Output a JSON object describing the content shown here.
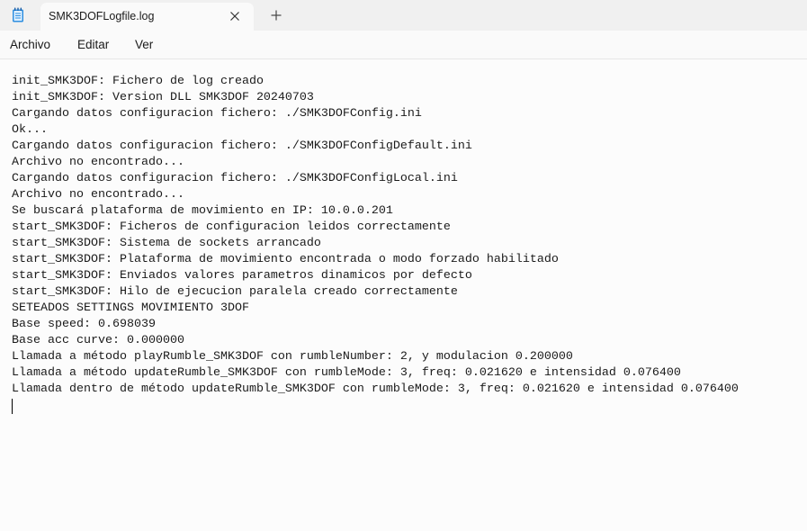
{
  "window": {
    "tab_title": "SMK3DOFLogfile.log"
  },
  "icons": {
    "app": "notepad-icon",
    "close": "close-icon",
    "new_tab": "plus-icon"
  },
  "menu": {
    "items": [
      "Archivo",
      "Editar",
      "Ver"
    ]
  },
  "editor": {
    "lines": [
      "init_SMK3DOF: Fichero de log creado",
      "init_SMK3DOF: Version DLL SMK3DOF 20240703",
      "Cargando datos configuracion fichero: ./SMK3DOFConfig.ini",
      "Ok...",
      "Cargando datos configuracion fichero: ./SMK3DOFConfigDefault.ini",
      "Archivo no encontrado...",
      "Cargando datos configuracion fichero: ./SMK3DOFConfigLocal.ini",
      "Archivo no encontrado...",
      "Se buscará plataforma de movimiento en IP: 10.0.0.201",
      "start_SMK3DOF: Ficheros de configuracion leidos correctamente",
      "start_SMK3DOF: Sistema de sockets arrancado",
      "start_SMK3DOF: Plataforma de movimiento encontrada o modo forzado habilitado",
      "start_SMK3DOF: Enviados valores parametros dinamicos por defecto",
      "start_SMK3DOF: Hilo de ejecucion paralela creado correctamente",
      "SETEADOS SETTINGS MOVIMIENTO 3DOF",
      "Base speed: 0.698039",
      "Base acc curve: 0.000000",
      "Llamada a método playRumble_SMK3DOF con rumbleNumber: 2, y modulacion 0.200000",
      "Llamada a método updateRumble_SMK3DOF con rumbleMode: 3, freq: 0.021620 e intensidad 0.076400",
      "Llamada dentro de método updateRumble_SMK3DOF con rumbleMode: 3, freq: 0.021620 e intensidad 0.076400"
    ]
  }
}
